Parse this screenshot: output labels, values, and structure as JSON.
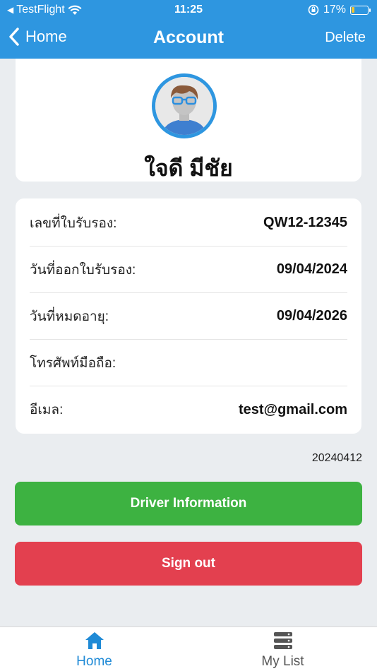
{
  "status_bar": {
    "back_app": "TestFlight",
    "time": "11:25",
    "battery_percent": "17%",
    "battery_level": 0.17
  },
  "nav": {
    "back_label": "Home",
    "title": "Account",
    "delete_label": "Delete"
  },
  "profile": {
    "name": "ใจดี มีชัย"
  },
  "info": {
    "rows": [
      {
        "label": "เลขที่ใบรับรอง:",
        "value": "QW12-12345"
      },
      {
        "label": "วันที่ออกใบรับรอง:",
        "value": "09/04/2024"
      },
      {
        "label": "วันที่หมดอายุ:",
        "value": "09/04/2026"
      },
      {
        "label": "โทรศัพท์มือถือ:",
        "value": ""
      },
      {
        "label": "อีเมล:",
        "value": "test@gmail.com"
      }
    ]
  },
  "version": "20240412",
  "buttons": {
    "driver_info": "Driver Information",
    "sign_out": "Sign out"
  },
  "tabs": [
    {
      "label": "Home",
      "icon": "home-icon",
      "active": true
    },
    {
      "label": "My List",
      "icon": "list-icon",
      "active": false
    }
  ],
  "colors": {
    "header": "#2e96e0",
    "driver_button": "#3db241",
    "signout_button": "#e3404f",
    "active_tab": "#1f8ad6"
  }
}
